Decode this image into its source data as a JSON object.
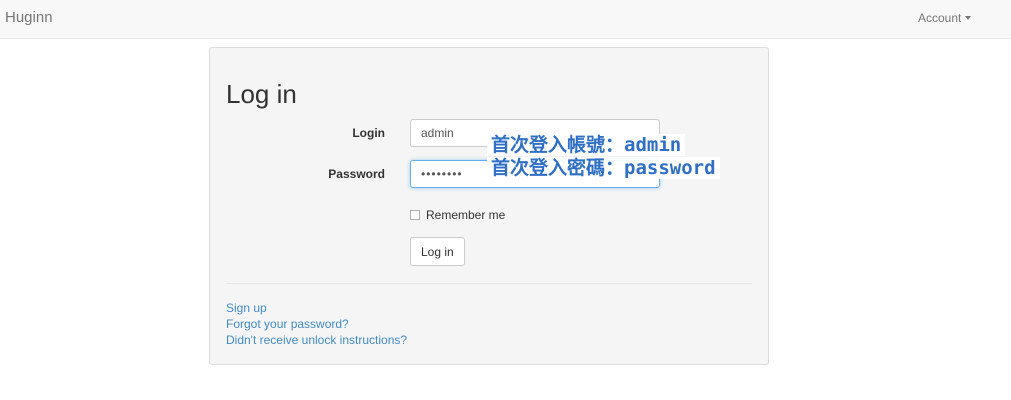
{
  "navbar": {
    "brand": "Huginn",
    "account_label": "Account"
  },
  "login_form": {
    "title": "Log in",
    "login_label": "Login",
    "login_value": "admin",
    "password_label": "Password",
    "password_value": "••••••••",
    "remember_label": "Remember me",
    "remember_checked": false,
    "submit_label": "Log in"
  },
  "links": {
    "sign_up": "Sign up",
    "forgot_password": "Forgot your password?",
    "unlock_instructions": "Didn't receive unlock instructions?"
  },
  "annotations": {
    "line1": "首次登入帳號：admin",
    "line2": "首次登入密碼：password"
  },
  "colors": {
    "link": "#428bca",
    "annotation": "#2f6fc6",
    "focus": "#66afe9"
  }
}
